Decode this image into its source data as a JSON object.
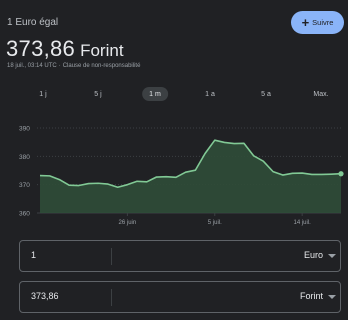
{
  "header": {
    "label": "1 Euro égal",
    "rate": "373,86",
    "currency": "Forint",
    "timestamp": "18 juil., 03:14 UTC",
    "separator": "·",
    "disclaimer": "Clause de non-responsabilité",
    "follow_label": "Suivre"
  },
  "ranges": [
    "1 j",
    "5 j",
    "1 m",
    "1 a",
    "5 a",
    "Max."
  ],
  "active_range": "1 m",
  "colors": {
    "background": "#202124",
    "line": "#81c995",
    "fill": "#2f4d39",
    "grid": "#3c4043",
    "axis_text": "#9aa0a6",
    "accent": "#8ab4f8"
  },
  "chart_data": {
    "type": "area",
    "x": [
      "17 juin",
      "18 juin",
      "19 juin",
      "20 juin",
      "21 juin",
      "22 juin",
      "23 juin",
      "24 juin",
      "25 juin",
      "26 juin",
      "27 juin",
      "28 juin",
      "29 juin",
      "30 juin",
      "1 juil.",
      "2 juil.",
      "3 juil.",
      "4 juil.",
      "5 juil.",
      "6 juil.",
      "7 juil.",
      "8 juil.",
      "9 juil.",
      "10 juil.",
      "11 juil.",
      "12 juil.",
      "13 juil.",
      "14 juil.",
      "15 juil.",
      "16 juil.",
      "17 juil.",
      "18 juil."
    ],
    "values": [
      373.2,
      373.1,
      371.8,
      369.8,
      369.7,
      370.4,
      370.5,
      370.2,
      369.1,
      370.0,
      371.2,
      371.0,
      372.7,
      372.8,
      372.6,
      374.4,
      375.1,
      381.0,
      385.7,
      384.9,
      384.5,
      384.6,
      380.2,
      378.3,
      374.6,
      373.4,
      374.0,
      374.1,
      373.6,
      373.6,
      373.7,
      373.86
    ],
    "yticks": [
      390,
      380,
      370,
      360
    ],
    "ylim": [
      360,
      390
    ],
    "xtick_labels": [
      "26 juin",
      "5 juil.",
      "14 juil."
    ],
    "xtick_positions": [
      "26 juin",
      "5 juil.",
      "14 juil."
    ],
    "grid": true
  },
  "converter": {
    "from_value": "1",
    "from_currency": "Euro",
    "to_value": "373,86",
    "to_currency": "Forint"
  }
}
